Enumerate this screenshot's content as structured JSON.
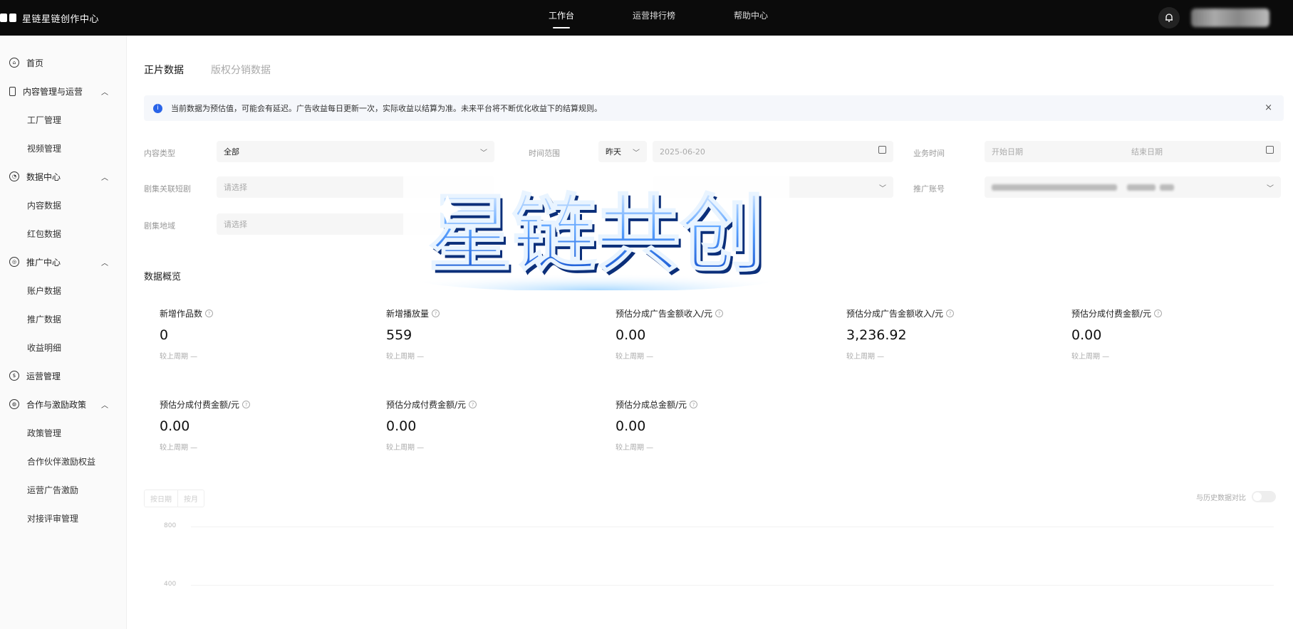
{
  "app": {
    "title": "星链星链创作中心",
    "nav": [
      "工作台",
      "运营排行榜",
      "帮助中心"
    ],
    "active_nav": 0
  },
  "sidebar": {
    "items": [
      {
        "label": "首页",
        "icon": "home-icon",
        "level": 0
      },
      {
        "label": "内容管理与运营",
        "icon": "phone-icon",
        "level": 0,
        "expanded": true
      },
      {
        "label": "工厂管理",
        "level": 1
      },
      {
        "label": "视频管理",
        "level": 1
      },
      {
        "label": "数据中心",
        "icon": "data-icon",
        "level": 0,
        "expanded": true
      },
      {
        "label": "内容数据",
        "level": 1
      },
      {
        "label": "红包数据",
        "level": 1
      },
      {
        "label": "推广中心",
        "icon": "target-icon",
        "level": 0,
        "expanded": true
      },
      {
        "label": "账户数据",
        "level": 1
      },
      {
        "label": "推广数据",
        "level": 1
      },
      {
        "label": "收益明细",
        "level": 1
      },
      {
        "label": "运营管理",
        "icon": "dollar-icon",
        "level": 0
      },
      {
        "label": "合作与激励政策",
        "icon": "gift-icon",
        "level": 0,
        "expanded": true
      },
      {
        "label": "政策管理",
        "level": 1
      },
      {
        "label": "合作伙伴激励权益",
        "level": 1
      },
      {
        "label": "运营广告激励",
        "level": 1
      },
      {
        "label": "对接评审管理",
        "level": 1
      }
    ]
  },
  "tabs": [
    "正片数据",
    "版权分销数据"
  ],
  "notice": {
    "text": "当前数据为预估值，可能会有延迟。广告收益每日更新一次，实际收益以结算为准。未来平台将不断优化收益下的结算规则。",
    "close": "×"
  },
  "filters": {
    "content_type_label": "内容类型",
    "content_type_value": "全部",
    "time_range_label": "时间范围",
    "time_range_value": "昨天",
    "time_date_value": "2025-06-20",
    "business_time_label": "业务时间",
    "business_start": "开始日期",
    "business_end": "结束日期",
    "series_label": "剧集关联短剧",
    "series_placeholder": "请选择",
    "account_label": "推广账号",
    "region_label": "剧集地域",
    "region_placeholder": "请选择"
  },
  "section_title": "数据概览",
  "metrics": [
    {
      "label": "新增作品数",
      "value": "0",
      "cmp": "较上周期 —"
    },
    {
      "label": "新增播放量",
      "value": "559",
      "cmp": "较上周期 —"
    },
    {
      "label": "预估分成广告金额收入/元",
      "value": "0.00",
      "cmp": "较上周期 —"
    },
    {
      "label": "预估分成广告金额收入/元",
      "value": "3,236.92",
      "cmp": "较上周期 —"
    },
    {
      "label": "预估分成付费金额/元",
      "value": "0.00",
      "cmp": "较上周期 —"
    },
    {
      "label": "预估分成付费金额/元",
      "value": "0.00",
      "cmp": "较上周期 —"
    },
    {
      "label": "预估分成付费金额/元",
      "value": "0.00",
      "cmp": "较上周期 —"
    },
    {
      "label": "预估分成总金额/元",
      "value": "0.00",
      "cmp": "较上周期 —"
    }
  ],
  "chart": {
    "toggle": [
      "按日期",
      "按月"
    ],
    "compare_label": "与历史数据对比",
    "y_ticks": [
      "800",
      "400"
    ]
  },
  "banner": {
    "text": "星链共创"
  },
  "colors": {
    "topbar": "#0b0b0b",
    "accent": "#2a64e8",
    "banner_blue": "#2d7bff"
  }
}
